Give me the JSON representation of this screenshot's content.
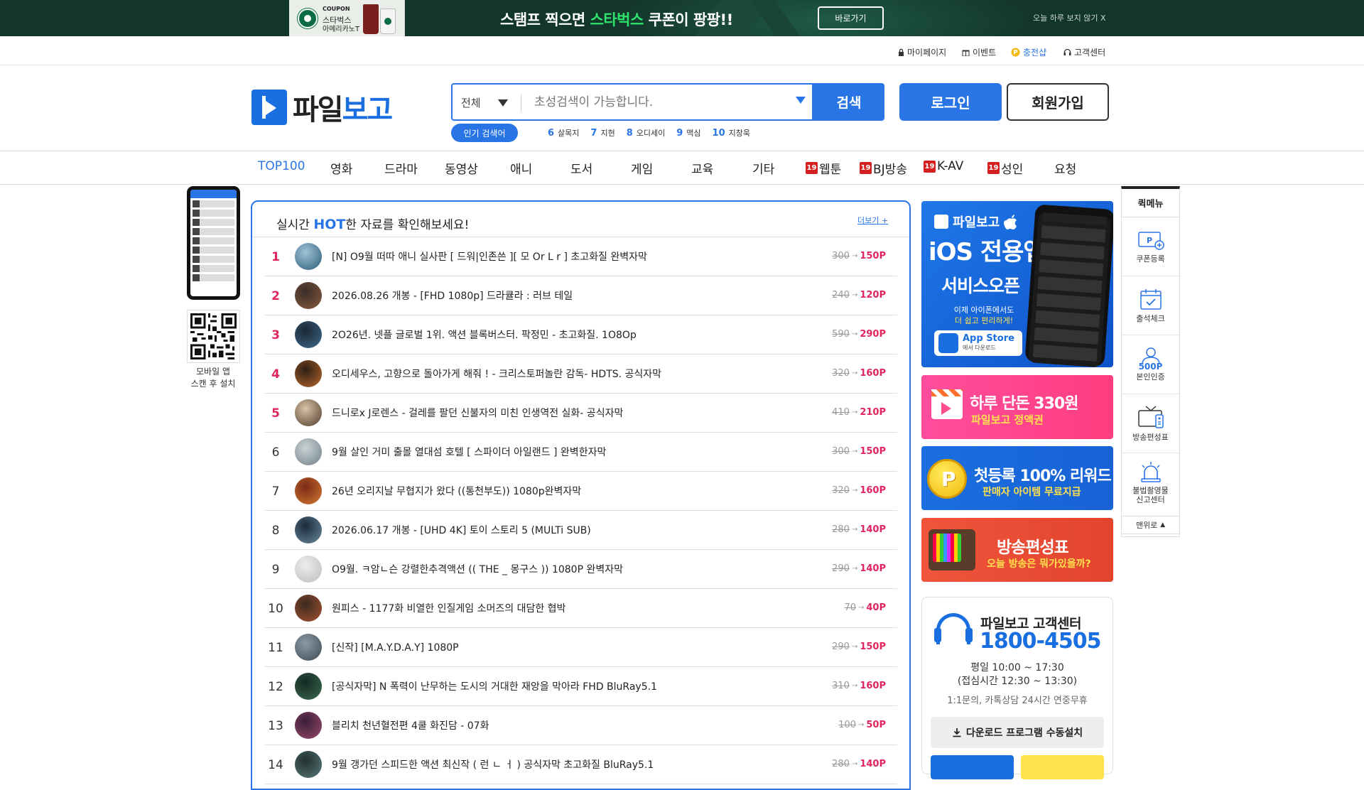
{
  "banner": {
    "coupon_tag": "COUPON",
    "coupon_line1": "스타벅스",
    "coupon_line2": "아메리카노T",
    "text_pre": "스탬프 찍으면 ",
    "text_hl": "스타벅스",
    "text_post": " 쿠폰이 팡팡!!",
    "button": "바로가기",
    "close": "오늘 하루 보지 않기 X",
    "accent_color": "#2ee36b"
  },
  "util": {
    "mypage": "마이페이지",
    "event": "이벤트",
    "charge": "충전샵",
    "support": "고객센터"
  },
  "header": {
    "logo_a": "파일",
    "logo_b": "보고",
    "search_category": "전체",
    "search_placeholder": "초성검색이 가능합니다.",
    "search_button": "검색",
    "login": "로그인",
    "join": "회원가입",
    "popular_tag": "인기 검색어",
    "popular": [
      {
        "n": "6",
        "kw": "살목지"
      },
      {
        "n": "7",
        "kw": "지현"
      },
      {
        "n": "8",
        "kw": "오디세이"
      },
      {
        "n": "9",
        "kw": "맥심"
      },
      {
        "n": "10",
        "kw": "지창욱"
      }
    ]
  },
  "nav": {
    "items": [
      {
        "label": "TOP100"
      },
      {
        "label": "영화"
      },
      {
        "label": "드라마"
      },
      {
        "label": "동영상"
      },
      {
        "label": "애니"
      },
      {
        "label": "도서"
      },
      {
        "label": "게임"
      },
      {
        "label": "교육"
      },
      {
        "label": "기타"
      },
      {
        "label": "웹툰",
        "badge": "19"
      },
      {
        "label": "BJ방송",
        "badge": "19"
      },
      {
        "label": "K-AV",
        "badge": "19"
      },
      {
        "label": "성인",
        "badge": "19"
      },
      {
        "label": "요청"
      }
    ]
  },
  "left": {
    "qr_caption_1": "모바일 앱",
    "qr_caption_2": "스캔 후 설치"
  },
  "hot": {
    "title_pre": "실시간 ",
    "title_hot": "HOT",
    "title_post": "한 자료를 확인해보세요!",
    "more": "더보기 +",
    "items": [
      {
        "rank": "1",
        "title": "[N] O9월 떠따 애니 실사판 [ 드워|인존쓴 ][ 모 Or L r ] 초고화질 완벽자막",
        "old": "300",
        "new": "150P"
      },
      {
        "rank": "2",
        "title": "2026.08.26 개봉 - [FHD 1080p] 드라큘라 : 러브 테일",
        "old": "240",
        "new": "120P"
      },
      {
        "rank": "3",
        "title": "2O26년. 넷플 글로벌 1위. 액션 블록버스터. 팍정민 - 초고화질. 1O8Op",
        "old": "590",
        "new": "290P"
      },
      {
        "rank": "4",
        "title": "오디세우스, 고향으로 돌아가게 해줘 ! - 크리스토퍼놀란 감독- HDTS. 공식자막",
        "old": "320",
        "new": "160P"
      },
      {
        "rank": "5",
        "title": "드니로x J로렌스 - 걸레를 팔던 신불자의 미친 인생역전 실화- 공식자막",
        "old": "410",
        "new": "210P"
      },
      {
        "rank": "6",
        "title": "9월 살인 거미 출몰 열대섬 호텔 [ 스파이더 아일랜드 ] 완벽한자막",
        "old": "300",
        "new": "150P"
      },
      {
        "rank": "7",
        "title": "26년 오리지날 무협지가 왔다 ((통천부도)) 1080p완벽자막",
        "old": "320",
        "new": "160P"
      },
      {
        "rank": "8",
        "title": "2026.06.17 개봉 - [UHD 4K] 토이 스토리 5 (MULTi SUB)",
        "old": "280",
        "new": "140P"
      },
      {
        "rank": "9",
        "title": "O9월. ㅋ암ㄴ슨 강렬한추격액션 (( THE _ 몽구스 )) 1080P 완벽자막",
        "old": "290",
        "new": "140P"
      },
      {
        "rank": "10",
        "title": "원피스 - 1177화 비열한 인질게임 소머즈의 대담한 협박",
        "old": "70",
        "new": "40P"
      },
      {
        "rank": "11",
        "title": "[신작] [M.A.Y.D.A.Y] 1080P",
        "old": "290",
        "new": "150P"
      },
      {
        "rank": "12",
        "title": "[공식자막] N 폭력이 난무하는 도시의 거대한 재앙을 막아라 FHD BluRay5.1",
        "old": "310",
        "new": "160P"
      },
      {
        "rank": "13",
        "title": "블리치 천년혈전편 4쿨 화진담 - 07화",
        "old": "100",
        "new": "50P"
      },
      {
        "rank": "14",
        "title": "9월 갱가던 스피드한 액션 최신작 ( 런 ㄴ ㅓ ) 공식자막 초고화질 BluRay5.1",
        "old": "280",
        "new": "140P"
      }
    ]
  },
  "right": {
    "ios_head": "파일보고",
    "ios_t1": "iOS 전용앱",
    "ios_t2": "서비스오픈",
    "ios_t3a": "이제 아이폰에서도",
    "ios_t3b": "더 쉽고 편리하게!",
    "ios_store": "App Store",
    "ios_store_sub": "에서 다운로드",
    "pink_l1": "하루 단돈 330원",
    "pink_l2": "파일보고 정액권",
    "blue_l1": "첫등록 100% 리워드",
    "blue_l2": "판매자 아이템 무료지급",
    "red_l1": "방송편성표",
    "red_l2": "오늘 방송은 뭐가있을까?",
    "cs_title": "파일보고 고객센터",
    "cs_phone": "1800-4505",
    "cs_hours1": "평일 10:00 ~ 17:30",
    "cs_hours2": "(접심시간 12:30 ~ 13:30)",
    "cs_note": "1:1문의, 카톡상담 24시간 연중무휴",
    "cs_download": "다운로드 프로그램 수동설치"
  },
  "quick": {
    "title": "퀵메뉴",
    "coupon": "쿠폰등록",
    "attend": "출석체크",
    "verify_pts": "500P",
    "verify": "본인인증",
    "tv": "방송편성표",
    "report1": "불법촬영물",
    "report2": "신고센터",
    "top": "맨위로"
  }
}
